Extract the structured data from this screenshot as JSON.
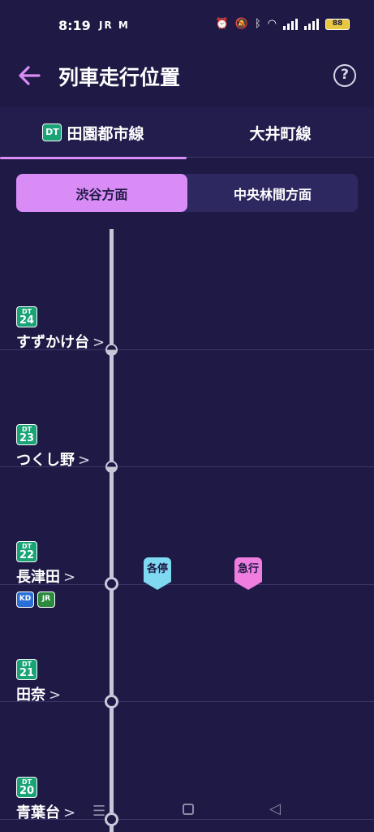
{
  "status_bar": {
    "time": "8:19",
    "left_icons": "JR M",
    "battery": "88"
  },
  "app_bar": {
    "title": "列車走行位置",
    "help": "?"
  },
  "tabs": [
    {
      "badge": "DT",
      "label": "田園都市線",
      "active": true
    },
    {
      "label": "大井町線",
      "active": false
    }
  ],
  "direction": {
    "options": [
      "渋谷方面",
      "中央林間方面"
    ],
    "selected": "渋谷方面"
  },
  "stations": [
    {
      "prefix": "DT",
      "number": "24",
      "name": "すずかけ台",
      "transfers": []
    },
    {
      "prefix": "DT",
      "number": "23",
      "name": "つくし野",
      "transfers": []
    },
    {
      "prefix": "DT",
      "number": "22",
      "name": "長津田",
      "transfers": [
        "KD",
        "JR"
      ]
    },
    {
      "prefix": "DT",
      "number": "21",
      "name": "田奈",
      "transfers": []
    },
    {
      "prefix": "DT",
      "number": "20",
      "name": "青葉台",
      "transfers": []
    }
  ],
  "trains": [
    {
      "type": "各停",
      "color": "#7fd9f0",
      "at_station": "22"
    },
    {
      "type": "急行",
      "color": "#f07ee0",
      "at_station": "22"
    }
  ],
  "colors": {
    "background": "#1f1a45",
    "accent": "#d98cf5",
    "line_dt": "#1aa376"
  },
  "icons": {
    "back": "arrow-left-icon",
    "help": "question-circle-icon",
    "chevron": ">"
  }
}
